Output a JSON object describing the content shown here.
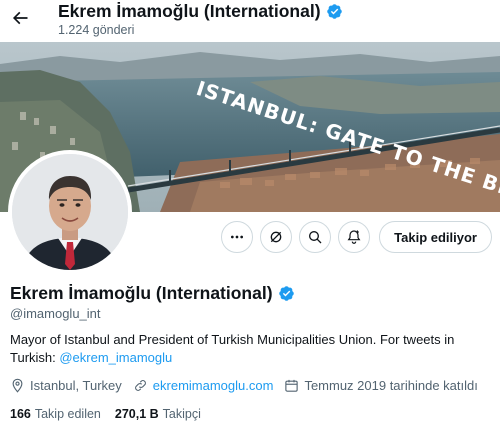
{
  "header": {
    "title": "Ekrem İmamoğlu (International)",
    "post_count": "1.224 gönderi"
  },
  "banner": {
    "text": "ISTANBUL: GATE TO THE BEYOND"
  },
  "actions": {
    "more_icon": "more-icon",
    "grok_icon": "grok-icon",
    "search_icon": "search-icon",
    "notify_icon": "notification-bell-icon",
    "follow_label": "Takip ediliyor"
  },
  "profile": {
    "name": "Ekrem İmamoğlu (International)",
    "handle": "@imamoglu_int",
    "bio_text": "Mayor of Istanbul and President of Turkish Municipalities Union. For tweets in Turkish: ",
    "bio_mention": "@ekrem_imamoglu",
    "location": "Istanbul, Turkey",
    "website": "ekremimamoglu.com",
    "joined": "Temmuz 2019 tarihinde katıldı"
  },
  "stats": {
    "following_count": "166",
    "following_label": "Takip edilen",
    "followers_count": "270,1 B",
    "followers_label": "Takipçi"
  },
  "colors": {
    "accent": "#1d9bf0",
    "text": "#0f1419",
    "muted": "#536471",
    "border": "#cfd9de"
  }
}
